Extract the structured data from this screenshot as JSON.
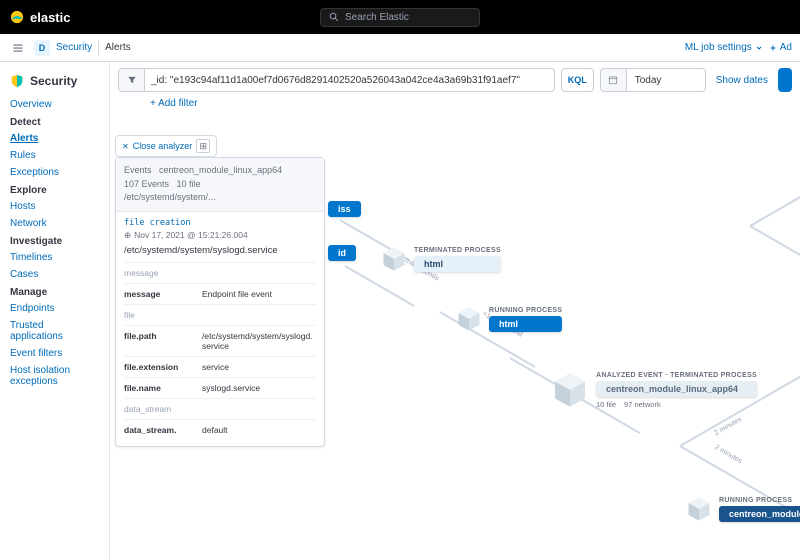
{
  "header": {
    "brand": "elastic",
    "search_placeholder": "Search Elastic"
  },
  "breadcrumbs": {
    "badge": "D",
    "items": [
      "Security",
      "Alerts"
    ],
    "ml_link": "ML job settings",
    "add_link": "Ad"
  },
  "sidebar": {
    "title": "Security",
    "groups": [
      {
        "label": "",
        "items": [
          "Overview"
        ]
      },
      {
        "label": "Detect",
        "items": [
          "Alerts",
          "Rules",
          "Exceptions"
        ]
      },
      {
        "label": "Explore",
        "items": [
          "Hosts",
          "Network"
        ]
      },
      {
        "label": "Investigate",
        "items": [
          "Timelines",
          "Cases"
        ]
      },
      {
        "label": "Manage",
        "items": [
          "Endpoints",
          "Trusted applications",
          "Event filters",
          "Host isolation exceptions"
        ]
      }
    ],
    "active": "Alerts"
  },
  "query": {
    "text": "_id: \"e193c94af11d1a00ef7d0676d8291402520a526043a042ce4a3a69b31f91aef7\"",
    "kql": "KQL",
    "date": "Today",
    "show_dates": "Show dates",
    "add_filter": "+ Add filter"
  },
  "analyzer": {
    "close": "Close analyzer",
    "head_events": "Events",
    "head_proc": "centreon_module_linux_app64",
    "head_count": "107 Events",
    "head_bucket": "10 file",
    "head_path": "/etc/systemd/system/...",
    "kind": "file creation",
    "timestamp": "Nov 17, 2021 @ 15:21:26.004",
    "filepath": "/etc/systemd/system/syslogd.service",
    "rows": [
      {
        "k_label": "message",
        "k": "message",
        "v": "Endpoint file event"
      },
      {
        "k_label": "file",
        "k": "file.path",
        "v": "/etc/systemd/system/syslogd.service"
      },
      {
        "k_label": "",
        "k": "file.extension",
        "v": "service"
      },
      {
        "k_label": "",
        "k": "file.name",
        "v": "syslogd.service"
      },
      {
        "k_label": "data_stream",
        "k": "data_stream.",
        "v": "default"
      }
    ]
  },
  "graph": {
    "nodes": [
      {
        "sup": "",
        "label": "iss",
        "cls": "label-blue"
      },
      {
        "sup": "",
        "label": "id",
        "cls": "label-blue"
      },
      {
        "sup": "TERMINATED PROCESS",
        "label": "html",
        "cls": "label-lite"
      },
      {
        "sup": "RUNNING PROCESS",
        "label": "html",
        "cls": "label-blue"
      },
      {
        "sup": "ANALYZED EVENT · TERMINATED PROCESS",
        "label": "centreon_module_linux_app64",
        "cls": "label-grey",
        "sub1": "10 file",
        "sub2": "97 network"
      },
      {
        "sup": "RUNNING PROCESS",
        "label": "centreon_module",
        "cls": "label-darker"
      }
    ],
    "edge_labels": [
      "164 milliseconds",
      "<1 millisecond",
      "2 minutes",
      "2 minutes"
    ]
  }
}
